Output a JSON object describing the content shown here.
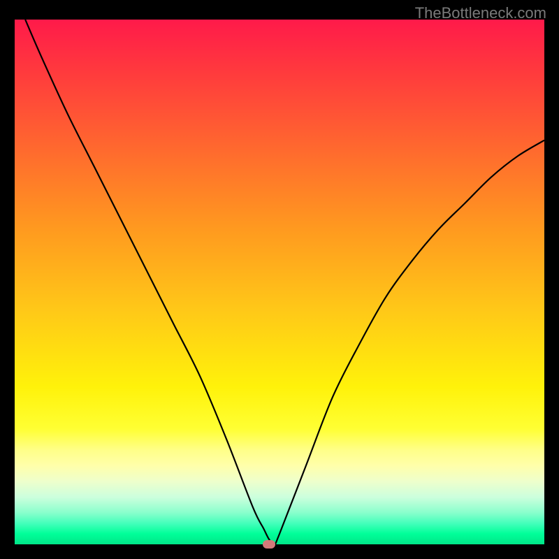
{
  "watermark": "TheBottleneck.com",
  "chart_data": {
    "type": "line",
    "title": "",
    "xlabel": "",
    "ylabel": "",
    "xlim": [
      0,
      100
    ],
    "ylim": [
      0,
      100
    ],
    "x": [
      2,
      5,
      10,
      15,
      20,
      25,
      30,
      35,
      40,
      45,
      47,
      48,
      49,
      50,
      55,
      60,
      65,
      70,
      75,
      80,
      85,
      90,
      95,
      100
    ],
    "values": [
      100,
      93,
      82,
      72,
      62,
      52,
      42,
      32,
      20,
      7,
      3,
      1,
      0,
      2,
      15,
      28,
      38,
      47,
      54,
      60,
      65,
      70,
      74,
      77
    ],
    "minimum_point": {
      "x": 48,
      "y": 0
    },
    "grid": false,
    "legend": false
  },
  "marker": {
    "color": "#d47a7a"
  }
}
